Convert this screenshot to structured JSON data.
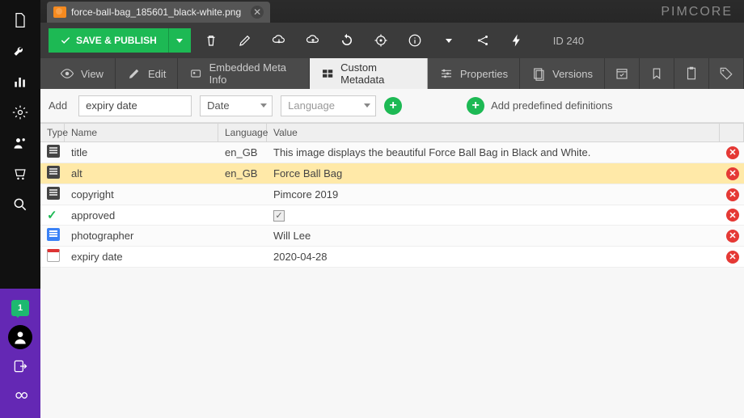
{
  "brand": "PIMCORE",
  "tab": {
    "filename": "force-ball-bag_185601_black-white.png"
  },
  "toolbar": {
    "publish": "SAVE & PUBLISH",
    "id_label": "ID 240"
  },
  "subtabs": {
    "view": "View",
    "edit": "Edit",
    "embedded": "Embedded Meta Info",
    "custom": "Custom Metadata",
    "properties": "Properties",
    "versions": "Versions"
  },
  "addrow": {
    "label": "Add",
    "name_value": "expiry date",
    "type_value": "Date",
    "lang_placeholder": "Language",
    "predefined": "Add predefined definitions"
  },
  "grid": {
    "headers": {
      "type": "Type",
      "name": "Name",
      "language": "Language",
      "value": "Value"
    },
    "rows": [
      {
        "icon": "text",
        "name": "title",
        "lang": "en_GB",
        "value": "This image displays the beautiful Force Ball Bag in Black and White."
      },
      {
        "icon": "text",
        "name": "alt",
        "lang": "en_GB",
        "value": "Force Ball Bag",
        "selected": true
      },
      {
        "icon": "text",
        "name": "copyright",
        "lang": "",
        "value": "Pimcore 2019"
      },
      {
        "icon": "check",
        "name": "approved",
        "lang": "",
        "value": "[checked]"
      },
      {
        "icon": "doc",
        "name": "photographer",
        "lang": "",
        "value": "Will Lee"
      },
      {
        "icon": "cal",
        "name": "expiry date",
        "lang": "",
        "value": "2020-04-28"
      }
    ]
  },
  "side_chat_count": "1"
}
